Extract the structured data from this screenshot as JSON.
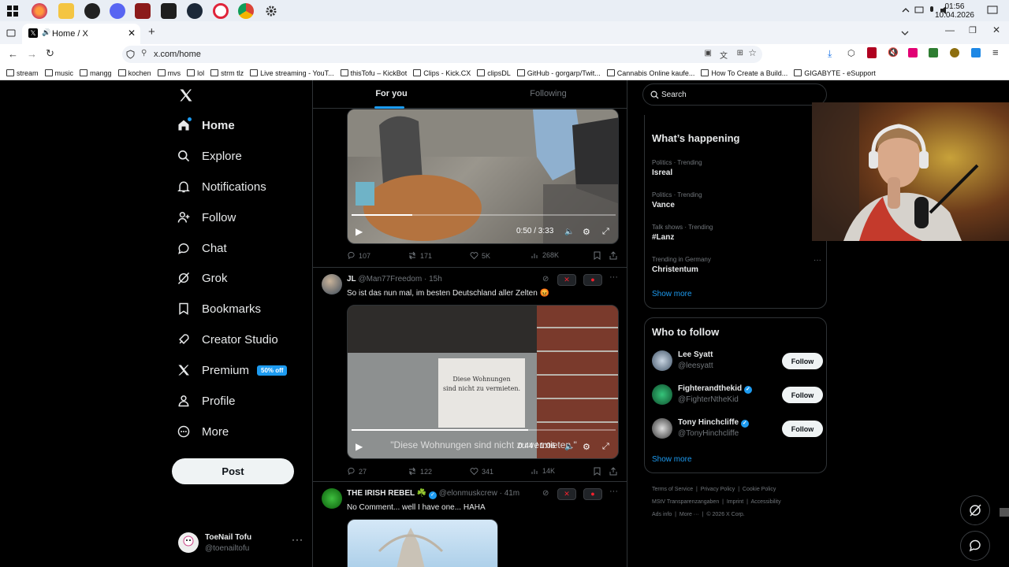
{
  "taskbar": {
    "clock_time": "01:56",
    "clock_date": "10.04.2026",
    "apps": [
      "windows-start-icon",
      "firefox-icon",
      "file-explorer-icon",
      "chrome-ext-icon",
      "discord-icon",
      "voicemeeter-icon",
      "terminal-icon",
      "steam-icon",
      "opera-icon",
      "chrome-icon",
      "settings-icon"
    ]
  },
  "browser": {
    "tab_title": "Home / X",
    "url": "x.com/home",
    "bookmarks": [
      "stream",
      "music",
      "mangg",
      "kochen",
      "mvs",
      "lol",
      "strm tlz",
      "Live streaming - YouT...",
      "thisTofu – KickBot",
      "Clips - Kick.CX",
      "clipsDL",
      "GitHub - gorgarp/Twit...",
      "Cannabis Online kaufe...",
      "How To Create a Build...",
      "GIGABYTE - eSupport"
    ]
  },
  "nav": {
    "items": [
      {
        "label": "Home",
        "icon": "home-icon"
      },
      {
        "label": "Explore",
        "icon": "search-icon"
      },
      {
        "label": "Notifications",
        "icon": "bell-icon"
      },
      {
        "label": "Follow",
        "icon": "person-add-icon"
      },
      {
        "label": "Chat",
        "icon": "chat-icon"
      },
      {
        "label": "Grok",
        "icon": "grok-icon"
      },
      {
        "label": "Bookmarks",
        "icon": "bookmark-icon"
      },
      {
        "label": "Creator Studio",
        "icon": "rocket-icon"
      },
      {
        "label": "Premium",
        "icon": "x-logo-icon"
      },
      {
        "label": "Profile",
        "icon": "person-icon"
      },
      {
        "label": "More",
        "icon": "more-circle-icon"
      }
    ],
    "premium_badge": "50% off",
    "post_label": "Post",
    "account_name": "ToeNail Tofu",
    "account_handle": "@toenailtofu"
  },
  "feed": {
    "tab_for_you": "For you",
    "tab_following": "Following",
    "tweet1": {
      "video_time": "0:50 / 3:33",
      "progress": 0.23,
      "replies": "107",
      "reposts": "171",
      "likes": "5K",
      "views": "268K"
    },
    "tweet2": {
      "name": "JL",
      "handle": "@Man77Freedom",
      "time": "15h",
      "text": "So ist das nun mal, im besten Deutschland aller Zelten 😡",
      "sign_line1": "Diese Wohnungen",
      "sign_line2": "sind nicht zu vermieten.",
      "caption": "\"Diese Wohnungen sind nicht zu vermieten.\"",
      "video_time": "0:44 / 1:06",
      "progress": 0.67,
      "replies": "27",
      "reposts": "122",
      "likes": "341",
      "views": "14K"
    },
    "tweet3": {
      "name": "THE IRISH REBEL ☘️",
      "handle": "@elonmuskcrew",
      "time": "41m",
      "text": "No Comment... well I have one... HAHA"
    }
  },
  "sidebar": {
    "search_placeholder": "Search",
    "trending_title": "What’s happening",
    "trends": [
      {
        "context": "Politics · Trending",
        "name": "Isreal"
      },
      {
        "context": "Politics · Trending",
        "name": "Vance"
      },
      {
        "context": "Talk shows · Trending",
        "name": "#Lanz"
      },
      {
        "context": "Trending in Germany",
        "name": "Christentum"
      }
    ],
    "show_more": "Show more",
    "who_to_follow_title": "Who to follow",
    "who_to_follow": [
      {
        "name": "Lee Syatt",
        "handle": "@leesyatt",
        "verified": false
      },
      {
        "name": "Fighterandthekid",
        "handle": "@FighterNtheKid",
        "verified": true
      },
      {
        "name": "Tony Hinchcliffe",
        "handle": "@TonyHinchcliffe",
        "verified": true
      }
    ],
    "follow_label": "Follow",
    "footer": {
      "line1": [
        "Terms of Service",
        "Privacy Policy",
        "Cookie Policy"
      ],
      "line2": [
        "MStV Transparenzangaben",
        "Imprint",
        "Accessibility"
      ],
      "line3": [
        "Ads info",
        "More ···",
        "© 2026 X Corp."
      ]
    }
  },
  "colors": {
    "accent": "#1d9bf0",
    "background": "#000000",
    "border": "#2f3336",
    "muted": "#71767b"
  }
}
